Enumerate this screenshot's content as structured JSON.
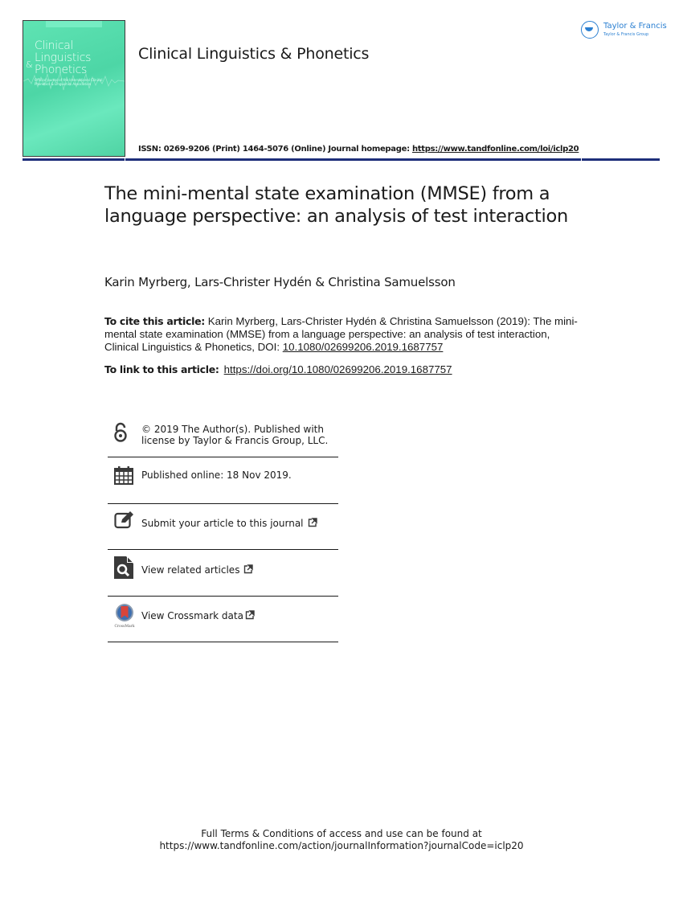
{
  "cover": {
    "title_line1": "Clinical",
    "title_line2": "Linguistics",
    "ampersand": "&",
    "title_line3": "Phonetics",
    "subtitle": "Official Journal of the International Clinical Phonetics & Linguistics Association"
  },
  "header": {
    "journal_title": "Clinical Linguistics & Phonetics",
    "publisher_name": "Taylor & Francis",
    "publisher_group": "Taylor & Francis Group",
    "issn_text": "ISSN: 0269-9206 (Print) 1464-5076 (Online) Journal homepage: ",
    "homepage_url": "https://www.tandfonline.com/loi/iclp20",
    "rule_color": "#1e2f7a"
  },
  "article": {
    "title": "The mini-mental state examination (MMSE) from a language perspective: an analysis of test interaction",
    "authors": "Karin Myrberg, Lars-Christer Hydén & Christina Samuelsson",
    "cite_label": "To cite this article:",
    "cite_text": " Karin Myrberg, Lars-Christer Hydén & Christina Samuelsson (2019): The mini-mental state examination (MMSE) from a language perspective: an analysis of test interaction, Clinical Linguistics & Phonetics, DOI: ",
    "doi": "10.1080/02699206.2019.1687757",
    "link_label": "To link to this article:",
    "link_url": "https://doi.org/10.1080/02699206.2019.1687757"
  },
  "info": {
    "license": "© 2019 The Author(s). Published with license by Taylor & Francis Group, LLC.",
    "license_line1": "© 2019 The Author(s). Published with",
    "license_line2": "license by Taylor & Francis Group, LLC.",
    "published": "Published online: 18 Nov 2019.",
    "submit": "Submit your article to this journal",
    "related": "View related articles",
    "crossmark": "View Crossmark data",
    "crossmark_caption": "CrossMark"
  },
  "footer": {
    "line1": "Full Terms & Conditions of access and use can be found at",
    "line2": "https://www.tandfonline.com/action/journalInformation?journalCode=iclp20"
  }
}
